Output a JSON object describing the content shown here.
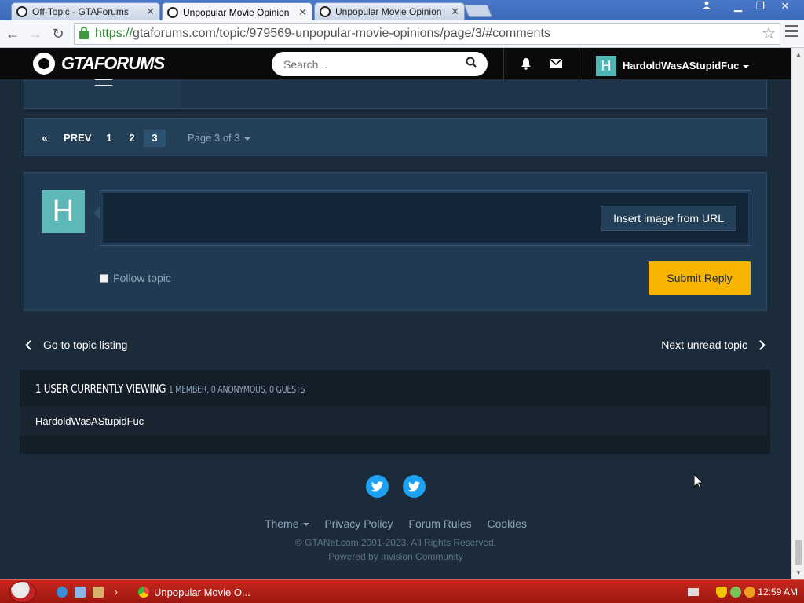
{
  "browser": {
    "tabs": [
      {
        "title": "Off-Topic - GTAForums"
      },
      {
        "title": "Unpopular Movie Opinion"
      },
      {
        "title": "Unpopular Movie Opinion"
      }
    ],
    "url_scheme": "https://",
    "url_rest": "gtaforums.com/topic/979569-unpopular-movie-opinions/page/3/#comments"
  },
  "header": {
    "logo_text": "GTAFORUMS",
    "search_placeholder": "Search...",
    "user_initial": "H",
    "username": "HardoldWasAStupidFuc"
  },
  "pagination": {
    "prev_label": "PREV",
    "pages": [
      "1",
      "2",
      "3"
    ],
    "current_page": "3",
    "page_info": "Page 3 of 3"
  },
  "reply": {
    "avatar_initial": "H",
    "insert_image_label": "Insert image from URL",
    "follow_label": "Follow topic",
    "submit_label": "Submit Reply"
  },
  "topic_nav": {
    "prev_label": "Go to topic listing",
    "next_label": "Next unread topic"
  },
  "viewing": {
    "title": "1 USER CURRENTLY VIEWING",
    "subtitle": "1 MEMBER, 0 ANONYMOUS, 0 GUESTS",
    "users": [
      "HardoldWasAStupidFuc"
    ]
  },
  "footer": {
    "links": [
      "Theme",
      "Privacy Policy",
      "Forum Rules",
      "Cookies"
    ],
    "copyright": "© GTANet.com 2001-2023. All Rights Reserved.",
    "powered": "Powered by Invision Community"
  },
  "taskbar": {
    "task_label": "Unpopular Movie O...",
    "clock": "12:59 AM"
  },
  "colors": {
    "page_bg": "#1c2b3a",
    "submit": "#f7b500",
    "avatar": "#5fb8b8",
    "twitter": "#1da1f2"
  }
}
